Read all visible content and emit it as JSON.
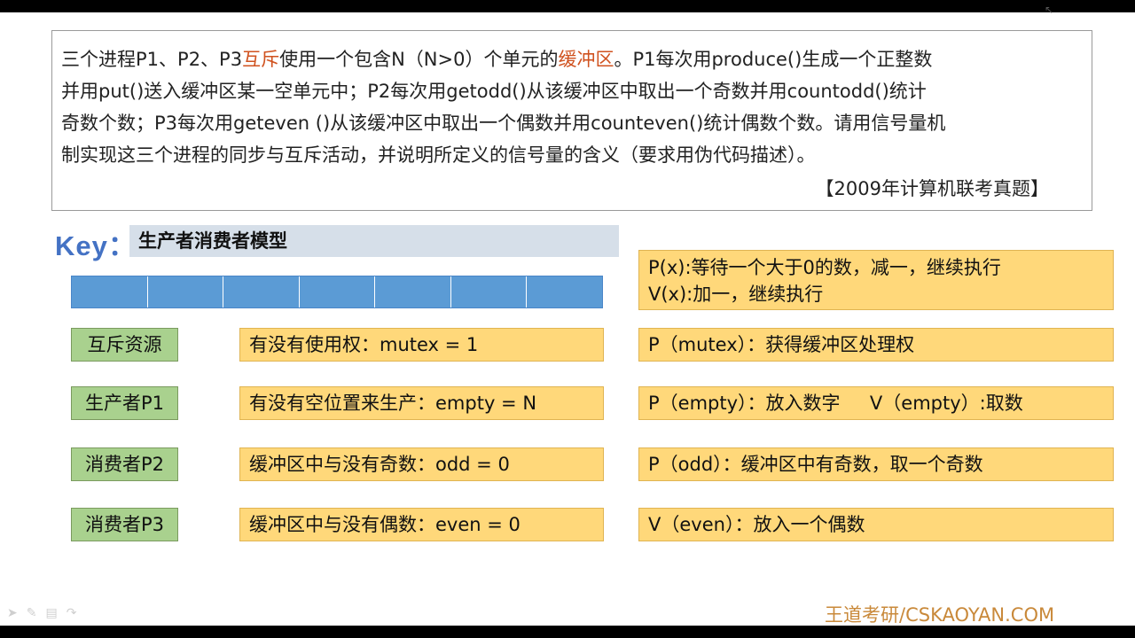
{
  "question": {
    "line1_a": "三个进程P1、P2、P3",
    "line1_hl1": "互斥",
    "line1_b": "使用一个包含N（N>0）个单元的",
    "line1_hl2": "缓冲区",
    "line1_c": "。P1每次用produce()生成一个正整数",
    "line2": "并用put()送入缓冲区某一空单元中；P2每次用getodd()从该缓冲区中取出一个奇数并用countodd()统计",
    "line3": "奇数个数；P3每次用geteven ()从该缓冲区中取出一个偶数并用counteven()统计偶数个数。请用信号量机",
    "line4": "制实现这三个进程的同步与互斥活动，并说明所定义的信号量的含义（要求用伪代码描述）。",
    "source": "【2009年计算机联考真题】"
  },
  "key_label": "Key：",
  "model_title": "生产者消费者模型",
  "buffer_cells": 7,
  "pv": {
    "p_def": "P(x):等待一个大于0的数，减一，继续执行",
    "v_def": "V(x):加一，继续执行"
  },
  "rows": [
    {
      "role": "互斥资源",
      "semaphore": "有没有使用权：mutex = 1",
      "operation": "P（mutex）：获得缓冲区处理权"
    },
    {
      "role": "生产者P1",
      "semaphore": "有没有空位置来生产：empty = N",
      "operation": "P（empty）：放入数字     V（empty）:取数"
    },
    {
      "role": "消费者P2",
      "semaphore": "缓冲区中与没有奇数：odd = 0",
      "operation": "P（odd）：缓冲区中有奇数，取一个奇数"
    },
    {
      "role": "消费者P3",
      "semaphore": "缓冲区中与没有偶数：even = 0",
      "operation": "V（even）：放入一个偶数"
    }
  ],
  "footer": "王道考研/CSKAOYAN.COM",
  "toolbar_icons": [
    "arrow-icon",
    "pen-icon",
    "menu-icon",
    "share-icon"
  ],
  "colors": {
    "highlight": "#d0521f",
    "key_blue": "#4472c4",
    "buffer_blue": "#5b9bd5",
    "role_green": "#a9d18e",
    "note_yellow": "#ffd87a",
    "footer_orange": "#c9893a"
  }
}
